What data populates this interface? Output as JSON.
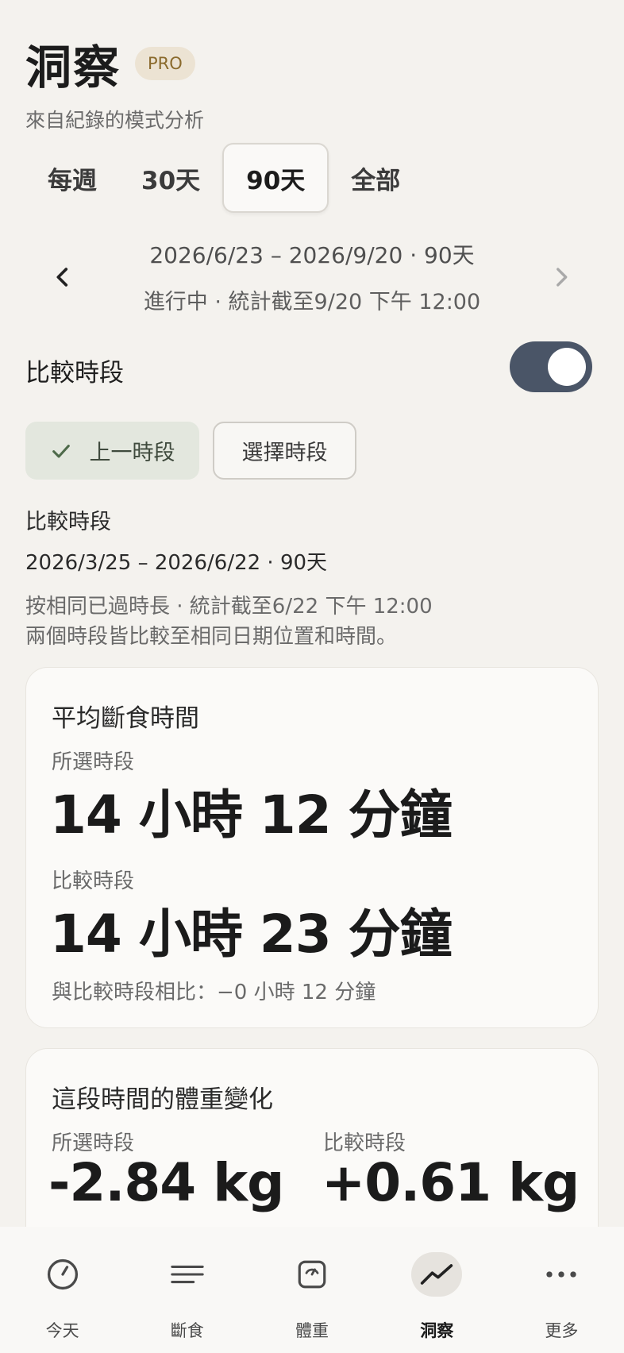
{
  "header": {
    "title": "洞察",
    "badge": "PRO",
    "subtitle": "來自紀錄的模式分析"
  },
  "range_tabs": [
    {
      "label": "每週",
      "active": false
    },
    {
      "label": "30天",
      "active": false
    },
    {
      "label": "90天",
      "active": true
    },
    {
      "label": "全部",
      "active": false
    }
  ],
  "period": {
    "range": "2026/6/23 – 2026/9/20 · 90天",
    "status": "進行中 · 統計截至9/20 下午 12:00"
  },
  "compare": {
    "label": "比較時段",
    "toggle_on": true,
    "chip_previous": "上一時段",
    "chip_select": "選擇時段",
    "info_label": "比較時段",
    "info_range": "2026/3/25 – 2026/6/22 · 90天",
    "info_note_1": "按相同已過時長 · 統計截至6/22 下午 12:00",
    "info_note_2": "兩個時段皆比較至相同日期位置和時間。"
  },
  "fasting_card": {
    "title": "平均斷食時間",
    "selected_label": "所選時段",
    "selected_value": "14 小時 12 分鐘",
    "compare_label": "比較時段",
    "compare_value": "14 小時 23 分鐘",
    "diff": "與比較時段相比：−0 小時 12 分鐘"
  },
  "weight_card": {
    "title": "這段時間的體重變化",
    "selected_label": "所選時段",
    "selected_value": "-2.84 kg",
    "compare_label": "比較時段",
    "compare_value": "+0.61 kg"
  },
  "tabbar": [
    {
      "label": "今天",
      "icon": "clock-icon",
      "active": false
    },
    {
      "label": "斷食",
      "icon": "lines-icon",
      "active": false
    },
    {
      "label": "體重",
      "icon": "scale-icon",
      "active": false
    },
    {
      "label": "洞察",
      "icon": "trend-icon",
      "active": true
    },
    {
      "label": "更多",
      "icon": "more-icon",
      "active": false
    }
  ],
  "colors": {
    "background": "#f4f2ee",
    "toggle": "#4a5567",
    "badge_bg": "#ece3d3",
    "badge_text": "#8a6a2c",
    "chip_selected_bg": "#e3e7de"
  }
}
